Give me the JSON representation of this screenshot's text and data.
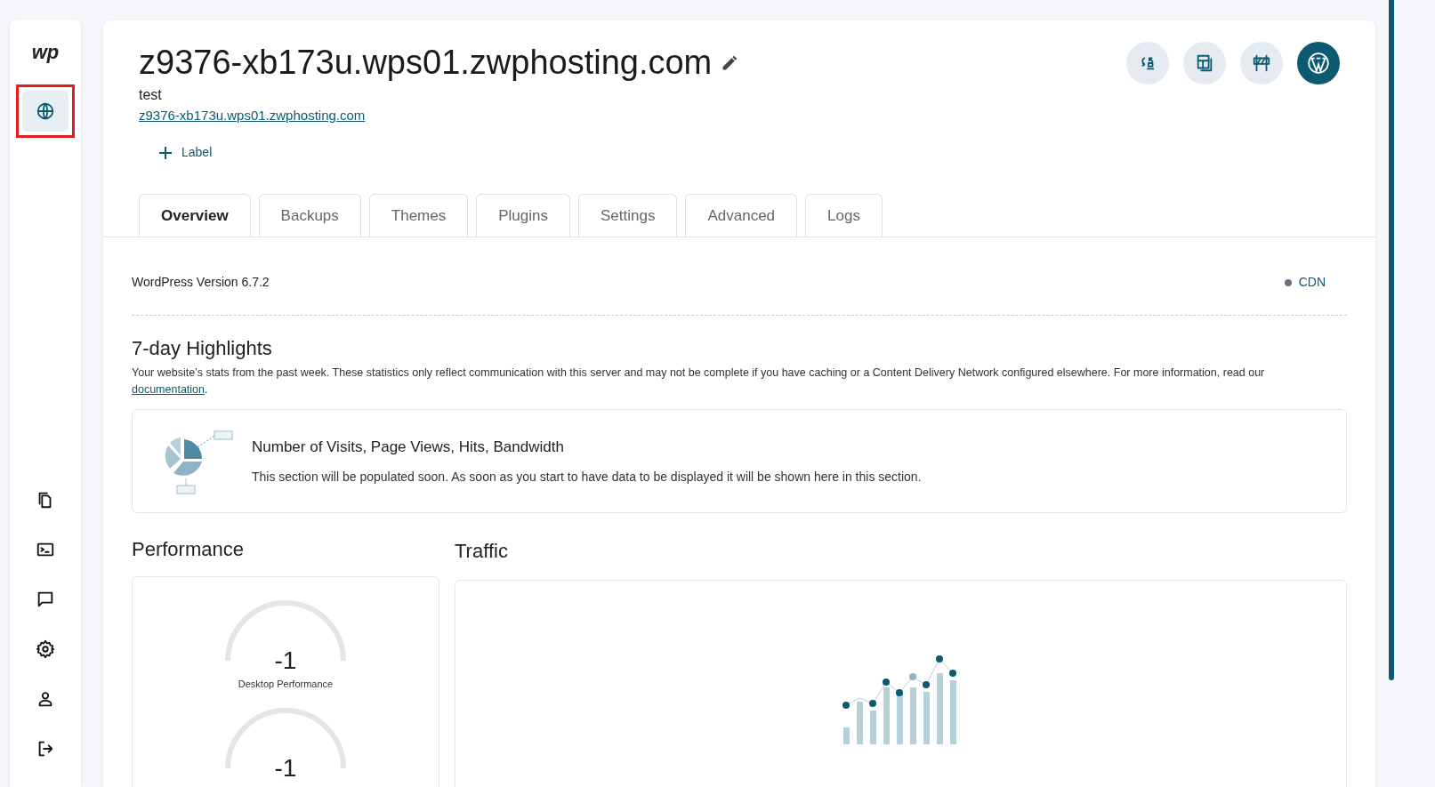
{
  "sidebar": {
    "logo": "wp",
    "top_items": [
      {
        "kind": "globe",
        "selected": true,
        "highlighted": true
      }
    ],
    "bottom_items": [
      {
        "kind": "files"
      },
      {
        "kind": "terminal"
      },
      {
        "kind": "chat"
      },
      {
        "kind": "settings"
      },
      {
        "kind": "user"
      },
      {
        "kind": "logout"
      }
    ]
  },
  "site": {
    "title": "z9376-xb173u.wps01.zwphosting.com",
    "description": "test",
    "url": "z9376-xb173u.wps01.zwphosting.com",
    "add_label": "Label"
  },
  "header_actions": [
    {
      "kind": "sync",
      "primary": false
    },
    {
      "kind": "layout",
      "primary": false
    },
    {
      "kind": "barrier",
      "primary": false
    },
    {
      "kind": "wordpress",
      "primary": true
    }
  ],
  "tabs": [
    {
      "label": "Overview",
      "selected": true
    },
    {
      "label": "Backups",
      "selected": false
    },
    {
      "label": "Themes",
      "selected": false
    },
    {
      "label": "Plugins",
      "selected": false
    },
    {
      "label": "Settings",
      "selected": false
    },
    {
      "label": "Advanced",
      "selected": false
    },
    {
      "label": "Logs",
      "selected": false
    }
  ],
  "overview": {
    "version": "WordPress Version 6.7.2",
    "cdn": {
      "label": "CDN",
      "color": "#6b7280"
    },
    "highlights": {
      "title": "7-day Highlights",
      "text": "Your website’s stats from the past week. These statistics only reflect communication with this server and may not be complete if you have caching or a Content Delivery Network configured elsewhere. For more information, read our ",
      "link": "documentation",
      "text_end": ".",
      "empty_title": "Number of Visits, Page Views, Hits, Bandwidth",
      "empty_text": "This section will be populated soon. As soon as you start to have data to be displayed it will be shown here in this section."
    },
    "performance": {
      "title": "Performance",
      "gauges": [
        {
          "value": "-1",
          "label": "Desktop Performance"
        },
        {
          "value": "-1"
        }
      ]
    },
    "traffic": {
      "title": "Traffic"
    }
  }
}
